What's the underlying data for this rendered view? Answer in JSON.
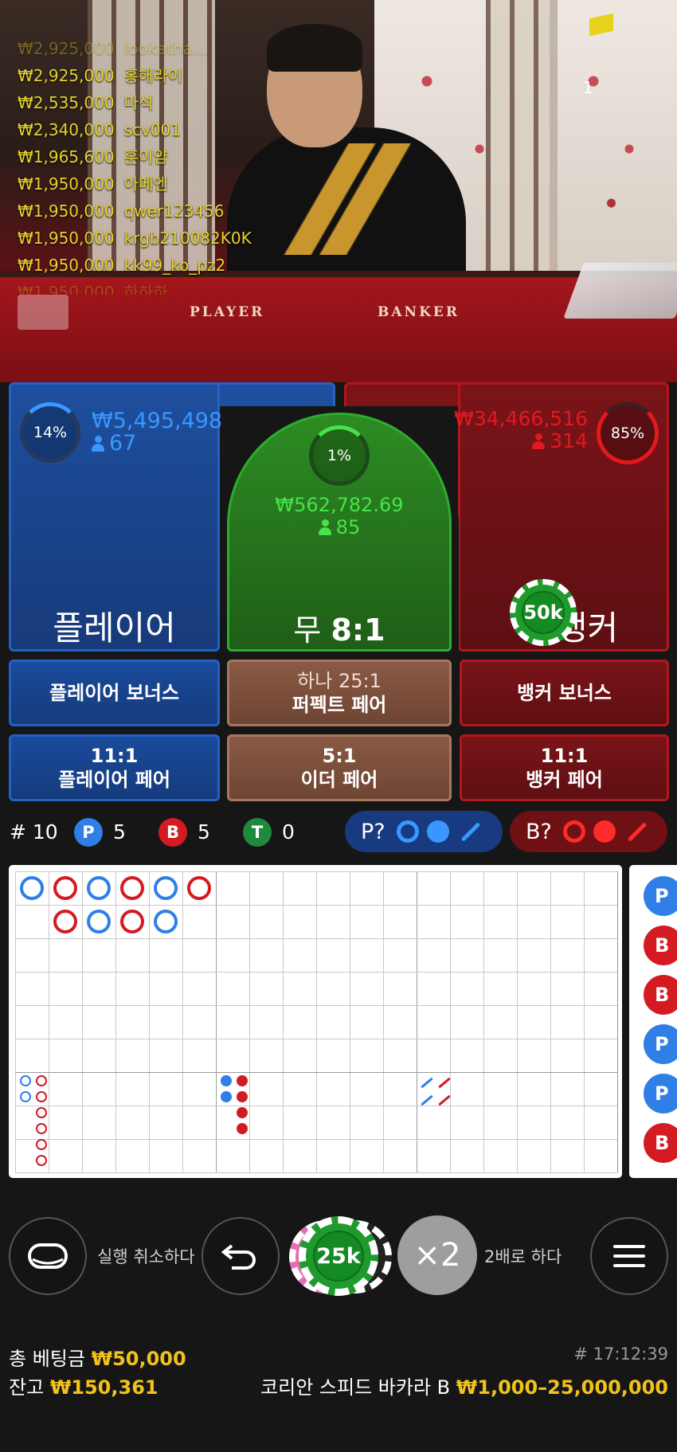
{
  "stream": {
    "felt_player_label": "PLAYER",
    "felt_banker_label": "BANKER",
    "viewer_count": "1",
    "winners": [
      {
        "amount": "₩2,925,000",
        "name": "lookatha..."
      },
      {
        "amount": "₩2,925,000",
        "name": "홍해라이"
      },
      {
        "amount": "₩2,535,000",
        "name": "마석"
      },
      {
        "amount": "₩2,340,000",
        "name": "scv001"
      },
      {
        "amount": "₩1,965,600",
        "name": "훈이얌"
      },
      {
        "amount": "₩1,950,000",
        "name": "아메엔"
      },
      {
        "amount": "₩1,950,000",
        "name": "qwer123456"
      },
      {
        "amount": "₩1,950,000",
        "name": "krgb210082K0K"
      },
      {
        "amount": "₩1,950,000",
        "name": "kk99_ko_pz2"
      },
      {
        "amount": "₩1,950,000",
        "name": "하하하"
      }
    ]
  },
  "bets": {
    "player": {
      "percent": "14%",
      "amount": "₩5,495,498",
      "players": "67",
      "label": "플레이어"
    },
    "tie": {
      "percent": "1%",
      "amount": "₩562,782.69",
      "players": "85",
      "label": "무",
      "odds": "8:1"
    },
    "banker": {
      "percent": "85%",
      "amount": "₩34,466,516",
      "players": "314",
      "label": "뱅커",
      "chip": "50k"
    },
    "side": {
      "player_bonus": "플레이어 보너스",
      "perfect_pair_odds": "하나 25:1",
      "perfect_pair": "퍼펙트 페어",
      "banker_bonus": "뱅커 보너스",
      "player_pair_odds": "11:1",
      "player_pair": "플레이어 페어",
      "either_pair_odds": "5:1",
      "either_pair": "이더 페어",
      "banker_pair_odds": "11:1",
      "banker_pair": "뱅커 페어"
    }
  },
  "stats": {
    "round": "# 10",
    "p_letter": "P",
    "p_count": "5",
    "b_letter": "B",
    "b_count": "5",
    "t_letter": "T",
    "t_count": "0",
    "player_predict": "P?",
    "banker_predict": "B?"
  },
  "roadmap": {
    "bead_plate": [
      [
        "P",
        "B",
        "P",
        "B",
        "P",
        "B"
      ],
      [
        "",
        "B",
        "P",
        "B",
        "P",
        ""
      ]
    ],
    "side_results": [
      "P",
      "B",
      "B",
      "P",
      "P",
      "B"
    ]
  },
  "controls": {
    "undo_label": "실행 취소하다",
    "chip_value": "25k",
    "double_symbol": "×2",
    "double_label": "2배로 하다"
  },
  "footer": {
    "total_bet_label": "총 베팅금",
    "total_bet": "₩50,000",
    "balance_label": "잔고",
    "balance": "₩150,361",
    "time": "# 17:12:39",
    "table_name": "코리안 스피드 바카라 B",
    "limits": "₩1,000–25,000,000"
  },
  "colors": {
    "player": "#2461c7",
    "banker": "#b3161c",
    "tie": "#2cad2e",
    "gold": "#f2c21b"
  }
}
